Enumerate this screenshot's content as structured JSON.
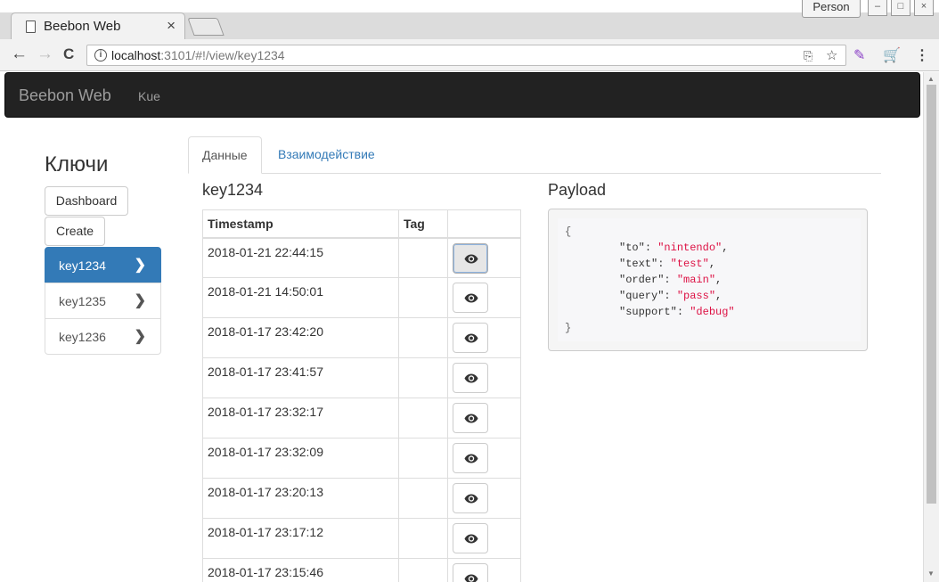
{
  "browser": {
    "tab_title": "Beebon Web",
    "tab_close": "×",
    "url_host": "localhost",
    "url_rest": ":3101/#!/view/key1234",
    "user_badge": "Person",
    "back": "←",
    "forward": "→",
    "reload": "C",
    "menu": "⋮"
  },
  "navbar": {
    "brand": "Beebon Web",
    "links": [
      "Kue"
    ]
  },
  "sidebar": {
    "title": "Ключи",
    "buttons": [
      "Dashboard",
      "Create"
    ],
    "keys": [
      {
        "label": "key1234",
        "active": true
      },
      {
        "label": "key1235",
        "active": false
      },
      {
        "label": "key1236",
        "active": false
      }
    ]
  },
  "tabs": [
    {
      "label": "Данные",
      "active": true
    },
    {
      "label": "Взаимодействие",
      "active": false
    }
  ],
  "main": {
    "key_title": "key1234",
    "table": {
      "headers": [
        "Timestamp",
        "Tag",
        ""
      ],
      "rows": [
        {
          "timestamp": "2018-01-21 22:44:15",
          "tag": "",
          "selected": true
        },
        {
          "timestamp": "2018-01-21 14:50:01",
          "tag": ""
        },
        {
          "timestamp": "2018-01-17 23:42:20",
          "tag": ""
        },
        {
          "timestamp": "2018-01-17 23:41:57",
          "tag": ""
        },
        {
          "timestamp": "2018-01-17 23:32:17",
          "tag": ""
        },
        {
          "timestamp": "2018-01-17 23:32:09",
          "tag": ""
        },
        {
          "timestamp": "2018-01-17 23:20:13",
          "tag": ""
        },
        {
          "timestamp": "2018-01-17 23:17:12",
          "tag": ""
        },
        {
          "timestamp": "2018-01-17 23:15:46",
          "tag": ""
        }
      ]
    }
  },
  "payload": {
    "title": "Payload",
    "open": "{",
    "close": "}",
    "fields": [
      {
        "key": "\"to\"",
        "value": "\"nintendo\"",
        "sep": ","
      },
      {
        "key": "\"text\"",
        "value": "\"test\"",
        "sep": ","
      },
      {
        "key": "\"order\"",
        "value": "\"main\"",
        "sep": ","
      },
      {
        "key": "\"query\"",
        "value": "\"pass\"",
        "sep": ","
      },
      {
        "key": "\"support\"",
        "value": "\"debug\"",
        "sep": ""
      }
    ]
  }
}
